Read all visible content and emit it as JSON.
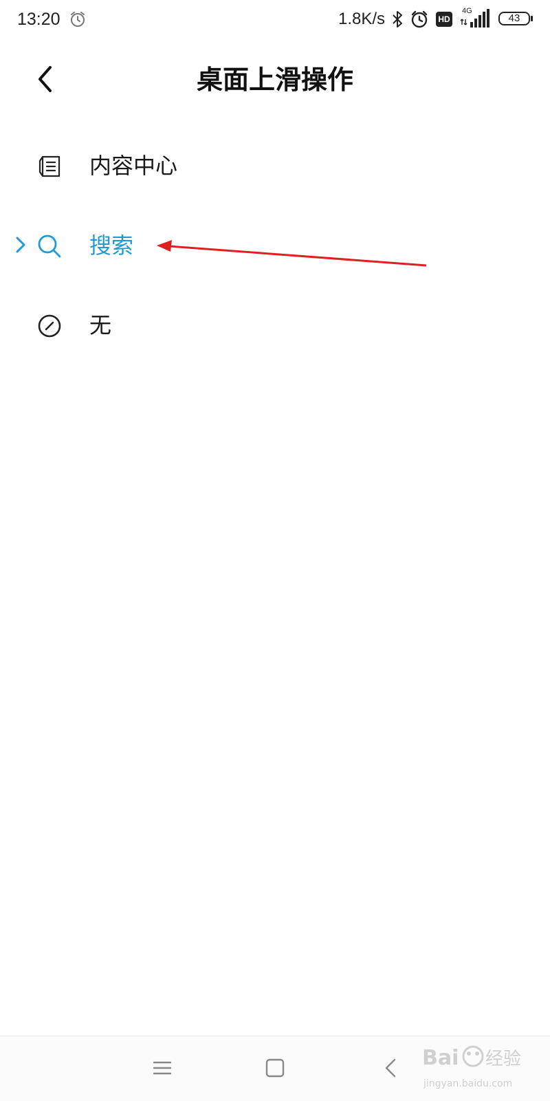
{
  "status_bar": {
    "time": "13:20",
    "net_speed": "1.8K/s",
    "hd_badge": "HD",
    "network_type": "4G",
    "battery_level": "43",
    "icons": [
      "alarm-icon",
      "bluetooth-icon",
      "alarm-icon",
      "hd-icon",
      "signal-icon",
      "battery-icon"
    ]
  },
  "header": {
    "back_icon": "chevron-left-icon",
    "title": "桌面上滑操作"
  },
  "options": [
    {
      "label": "内容中心",
      "icon": "news-feed-icon",
      "selected": false
    },
    {
      "label": "搜索",
      "icon": "search-icon",
      "selected": true
    },
    {
      "label": "无",
      "icon": "none-circle-icon",
      "selected": false
    }
  ],
  "colors": {
    "accent": "#1e9bd7",
    "annotation": "#e02020",
    "text": "#1a1a1a"
  },
  "nav_bar": {
    "icons": [
      "menu-icon",
      "home-icon",
      "back-icon"
    ]
  },
  "watermark": {
    "text": "Baidu经验",
    "url_text": "jingyan.baidu.com"
  }
}
